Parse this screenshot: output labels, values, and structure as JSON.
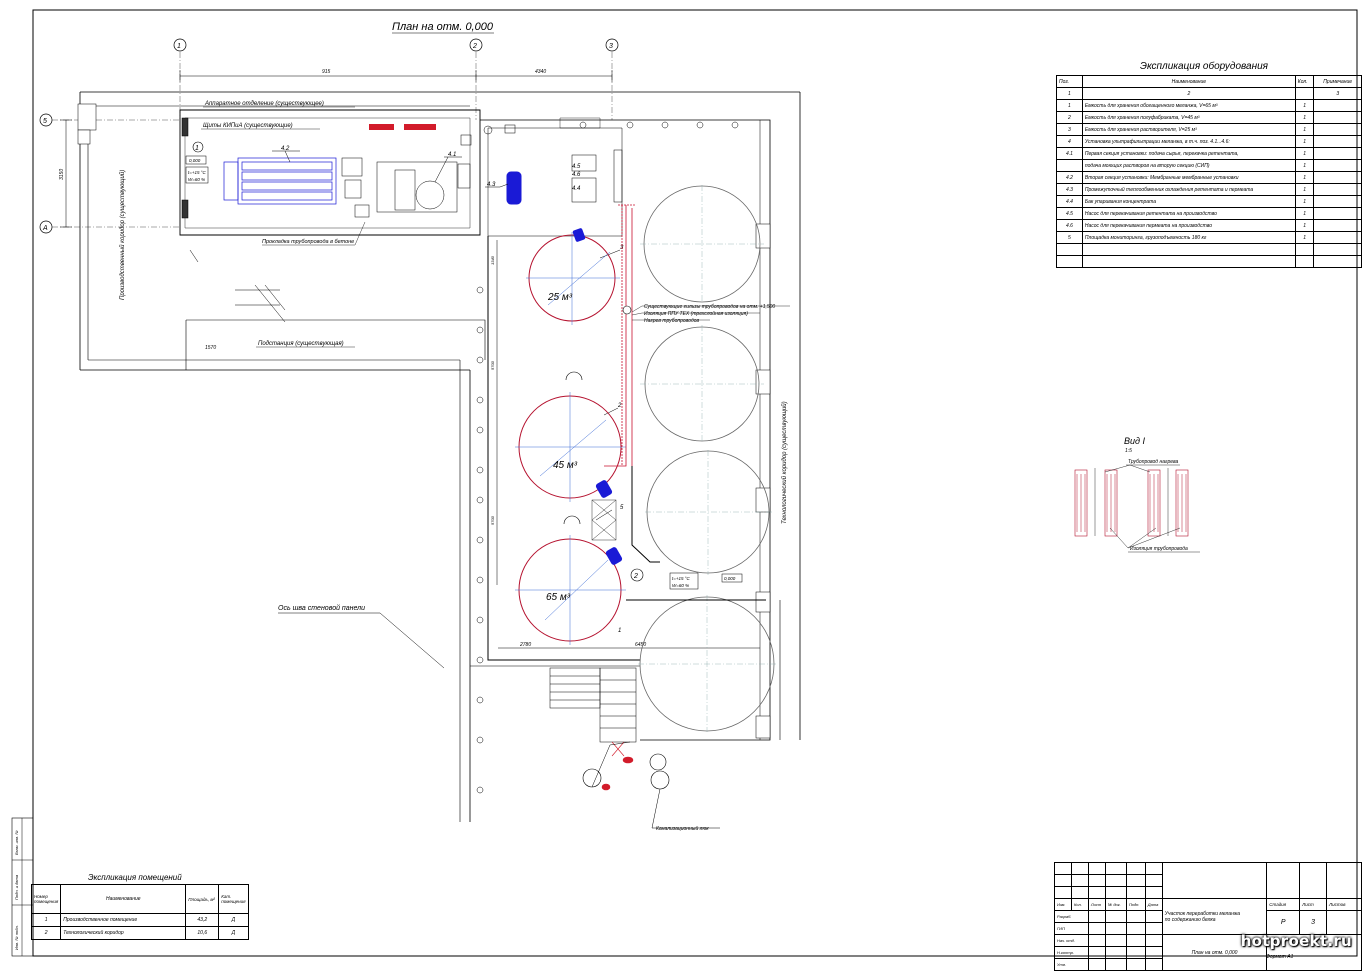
{
  "plan": {
    "title": "План на отм. 0,000",
    "axes": [
      "1",
      "2",
      "3",
      "5",
      "А"
    ],
    "dims": [
      "915",
      "4340",
      "3150",
      "1340",
      "5700",
      "5700",
      "5950",
      "2380",
      "5360",
      "1570",
      "2780",
      "6450",
      "1900",
      "6000"
    ],
    "elev_marks": [
      "0,000",
      "0,000",
      "0,000",
      "0,000"
    ],
    "temp_marks": [
      "t=+15 °C",
      "W=60 %",
      "t=+15 °C",
      "W=60 %"
    ],
    "callouts": [
      "1",
      "4.2",
      "4.1",
      "4.3",
      "4.4",
      "4.5",
      "4.6",
      "5",
      "3",
      "2",
      "1",
      "2"
    ],
    "volumes": [
      "25 м³",
      "45 м³",
      "65 м³"
    ],
    "notes": {
      "aggregate": "Аппаратное отделение (существующее)",
      "shields": "Щиты КИПиА (существующие)",
      "corridor_left": "Производственный коридор (существующий)",
      "corridor_right": "Технологический коридор (существующий)",
      "substation": "Подстанция (существующая)",
      "pipe_note": "Прокладка трубопровода в бетоне",
      "pipe_sleeve": "Существующие гильзы трубопроводов на отм. +1,500",
      "insulation": "Изоляция ППУ ТЕХ (трехслойная изоляция)",
      "heating": "Нагрев трубопроводов",
      "panel_axis": "Ось шва стеновой панели",
      "sewer": "Канализационный люк"
    }
  },
  "view": {
    "title": "Вид I",
    "scale": "1:5",
    "label_top": "Трубопровод нагрева",
    "label_bottom": "Изоляция трубопровода"
  },
  "equipment": {
    "title": "Экспликация оборудования",
    "headers": [
      "Поз.",
      "Наименование",
      "Кол.",
      "Примечание"
    ],
    "rows": [
      [
        "1",
        "2",
        "",
        "3"
      ],
      [
        "1",
        "Емкость для хранения обогащенного меланжа, V=65 м³",
        "1",
        ""
      ],
      [
        "2",
        "Емкость для хранения полуфабриката, V=45 м³",
        "1",
        ""
      ],
      [
        "3",
        "Емкость для хранения растворителя, V=25 м³",
        "1",
        ""
      ],
      [
        "4",
        "Установка ультрафильтрации меланжа, в т.ч. поз. 4.1...4.6:",
        "1",
        ""
      ],
      [
        "4.1",
        "Первая секция установки: подача сырья, перекачка ретентата,",
        "1",
        ""
      ],
      [
        "",
        "подача моющих растворов на вторую секцию (СИП)",
        "1",
        ""
      ],
      [
        "4.2",
        "Вторая секция установки: Мембранные мембранные установки",
        "1",
        ""
      ],
      [
        "4.3",
        "Промежуточный теплообменник охлаждения ретентата и пермеата",
        "1",
        ""
      ],
      [
        "4.4",
        "Бак упаривания концентрата",
        "1",
        ""
      ],
      [
        "4.5",
        "Насос для перекачивания ретентата на производство",
        "1",
        ""
      ],
      [
        "4.6",
        "Насос для перекачивания пермеата на производство",
        "1",
        ""
      ],
      [
        "5",
        "Площадка мониторинга, грузоподъемность 180 кг",
        "1",
        ""
      ],
      [
        "",
        "",
        "",
        ""
      ],
      [
        "",
        "",
        "",
        ""
      ]
    ]
  },
  "rooms": {
    "title": "Экспликация помещений",
    "headers": [
      "Номер помещения",
      "Наименование",
      "Площадь, м²",
      "Кат. помещения"
    ],
    "rows": [
      [
        "1",
        "Производственное помещение",
        "43,2",
        "Д"
      ],
      [
        "2",
        "Технологический коридор",
        "10,6",
        "Д"
      ]
    ]
  },
  "stamp": {
    "cols": [
      "Изм.",
      "Кол.",
      "Лист",
      "№ док.",
      "Подп.",
      "Дата"
    ],
    "roles": [
      "Разраб.",
      "ГИП",
      "Нач. отд.",
      "Н.контр.",
      "Утв."
    ],
    "project": "Участок переработки меланжа",
    "subproject": "по содержанию белка",
    "drawing": "План на отм. 0,000",
    "stage_head": "Стадия",
    "sheet_head": "Лист",
    "sheets_head": "Листов",
    "stage": "Р",
    "sheet": "3",
    "format": "Формат А1"
  },
  "margin_labels": [
    "Инв. № подл.",
    "Подп. и дата",
    "Взам. инв. №"
  ],
  "watermark": "hotproekt.ru",
  "colors": {
    "vessel": "#b5122f",
    "blue": "#1a1ad6",
    "pipe": "#c8102e"
  }
}
